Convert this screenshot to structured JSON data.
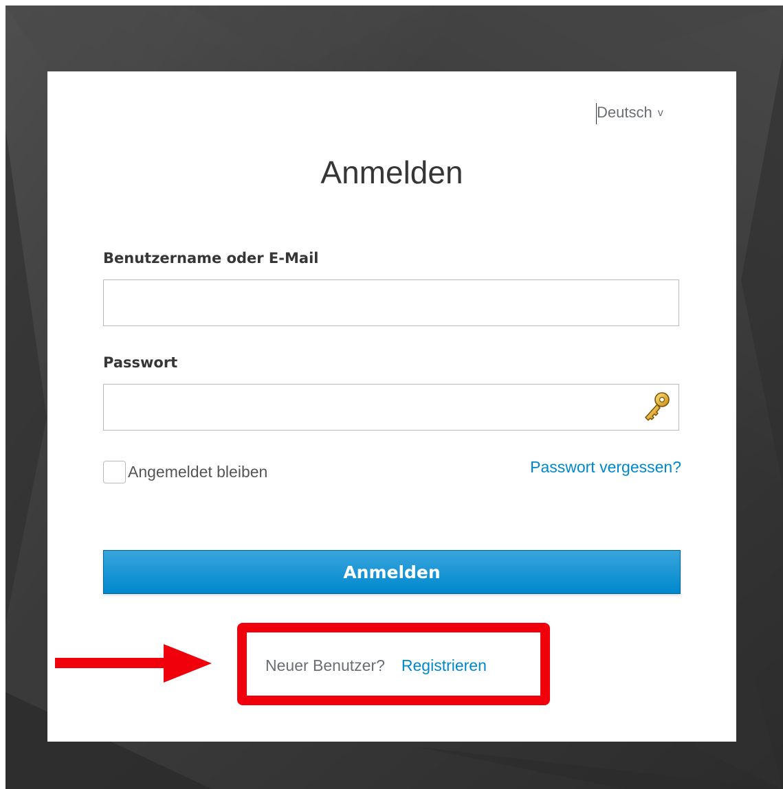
{
  "language": {
    "selected": "Deutsch",
    "chevron": "v"
  },
  "login": {
    "title": "Anmelden",
    "username_label": "Benutzername oder E-Mail",
    "username_value": "",
    "password_label": "Passwort",
    "password_value": "",
    "password_manager_icon": "key-icon",
    "remember_me_label": "Angemeldet bleiben",
    "remember_me_checked": false,
    "forgot_password_link": "Passwort vergessen?",
    "submit_label": "Anmelden"
  },
  "registration": {
    "question": "Neuer Benutzer?",
    "link": "Registrieren"
  },
  "annotation": {
    "color": "#f0000a",
    "arrow_icon": "arrow-right-icon"
  },
  "colors": {
    "accent": "#0088ce",
    "background": "#3a3a3a"
  }
}
